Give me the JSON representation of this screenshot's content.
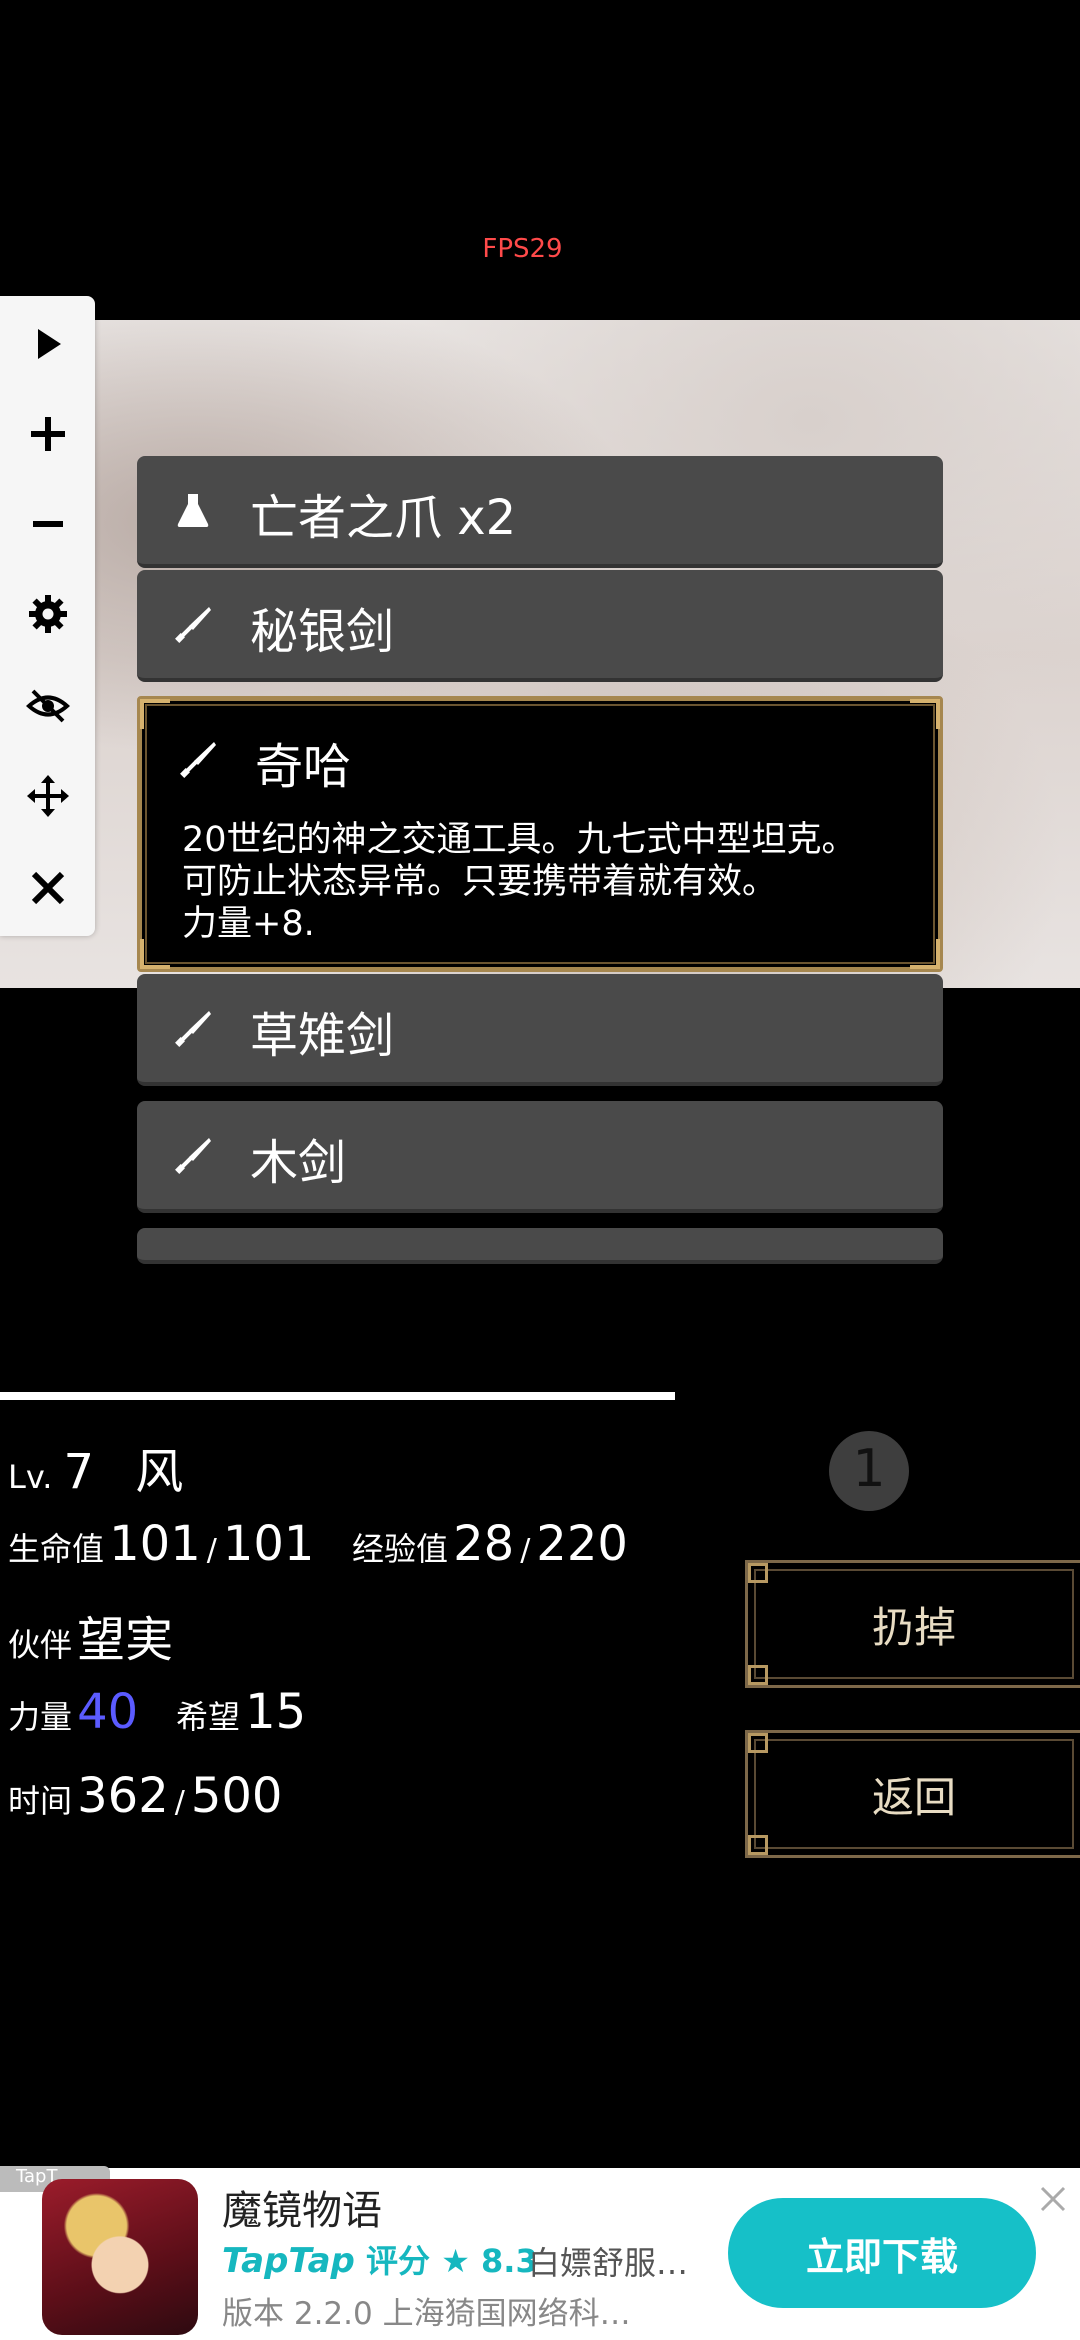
{
  "hud": {
    "fps": "FPS29"
  },
  "toolbar": [
    "play-icon",
    "plus-icon",
    "minus-icon",
    "gear-icon",
    "eye-off-icon",
    "move-icon",
    "close-icon"
  ],
  "items": [
    {
      "icon": "flask-icon",
      "name": "亡者之爪 x2"
    },
    {
      "icon": "sword-icon",
      "name": "秘银剑"
    },
    {
      "icon": "sword-icon",
      "name": "奇哈",
      "selected": true,
      "description": [
        "20世纪的神之交通工具。九七式中型坦克。",
        "可防止状态异常。只要携带着就有效。",
        "力量+8."
      ]
    },
    {
      "icon": "sword-icon",
      "name": "草雉剑"
    },
    {
      "icon": "sword-icon",
      "name": "木剑"
    }
  ],
  "stats": {
    "level_label": "Lv.",
    "level": "7",
    "name": "风",
    "hp_label": "生命值",
    "hp_current": "101",
    "hp_max": "101",
    "exp_label": "经验值",
    "exp_current": "28",
    "exp_max": "220",
    "partner_label": "伙伴",
    "partner": "望実",
    "str_label": "力量",
    "str": "40",
    "hope_label": "希望",
    "hope": "15",
    "time_label": "时间",
    "time_current": "362",
    "time_max": "500",
    "slash": "/",
    "str_color": "#5b5bff"
  },
  "counter": "1",
  "actions": {
    "drop": "扔掉",
    "back": "返回"
  },
  "ad": {
    "tag": "TapT",
    "title": "魔镜物语",
    "taptap": "TapTap",
    "rating_label": "评分",
    "rating": "8.3",
    "developer": "白嫖舒服…",
    "version": "版本 2.2.0  上海猗国网络科…",
    "download": "立即下载",
    "accent": "#16c0c8"
  }
}
